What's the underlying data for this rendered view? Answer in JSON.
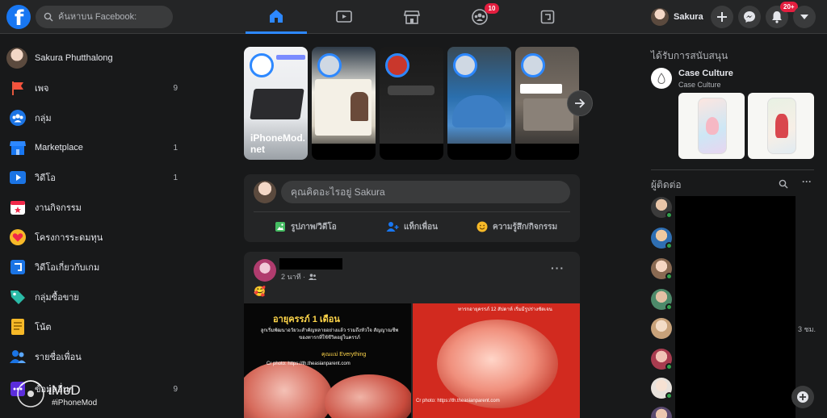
{
  "header": {
    "logo_letter": "f",
    "search_placeholder": "ค้นหาบน Facebook:",
    "nav_tabs": [
      {
        "name": "home",
        "active": true
      },
      {
        "name": "watch"
      },
      {
        "name": "marketplace"
      },
      {
        "name": "groups",
        "badge": "10"
      },
      {
        "name": "gaming"
      }
    ],
    "profile_name": "Sakura",
    "notifications_badge": "20+"
  },
  "sidebar": {
    "profile_name": "Sakura Phutthalong",
    "items": [
      {
        "label": "เพจ",
        "count": "9",
        "icon": "flag-icon"
      },
      {
        "label": "กลุ่ม",
        "count": "",
        "icon": "groups-icon"
      },
      {
        "label": "Marketplace",
        "count": "1",
        "icon": "shop-icon"
      },
      {
        "label": "วิดีโอ",
        "count": "1",
        "icon": "video-icon"
      },
      {
        "label": "งานกิจกรรม",
        "count": "",
        "icon": "calendar-icon"
      },
      {
        "label": "โครงการระดมทุน",
        "count": "",
        "icon": "heart-icon"
      },
      {
        "label": "วิดีโอเกี่ยวกับเกม",
        "count": "",
        "icon": "gaming-icon"
      },
      {
        "label": "กลุ่มซื้อขาย",
        "count": "",
        "icon": "tag-icon"
      },
      {
        "label": "โน้ต",
        "count": "",
        "icon": "notes-icon"
      },
      {
        "label": "รายชื่อเพื่อน",
        "count": "",
        "icon": "friends-icon"
      },
      {
        "label": "ข้อมูลอื่นๆ",
        "count": "9",
        "icon": "more-icon"
      }
    ],
    "watermark_brand": "iMoD",
    "watermark_handle": "#iPhoneMod"
  },
  "stories": {
    "items": [
      {
        "name": "iPhoneMod.\nnet",
        "ring": true
      },
      {
        "name": "",
        "ring": true
      },
      {
        "name": "",
        "ring": true
      },
      {
        "name": "",
        "ring": true
      },
      {
        "name": "",
        "ring": true
      }
    ]
  },
  "composer": {
    "placeholder": "คุณคิดอะไรอยู่ Sakura",
    "photo_label": "รูปภาพ/วิดีโอ",
    "tag_label": "แท็กเพื่อน",
    "feeling_label": "ความรู้สึก/กิจกรรม"
  },
  "post": {
    "time": "2 นาที ·",
    "emoji": "🥰",
    "left_title": "อายุครรภ์ 1 เดือน",
    "left_body": "ลูกเริ่มพัฒนาอวัยวะสำคัญหลายอย่างแล้ว รวมถึงหัวใจ สัญญาณชีพของทารกที่ใช้ชีวิตอยู่ในครรภ์",
    "left_tag": "คุณแม่ Everything",
    "left_credit": "Cr photo: https://th.theasianparent.com",
    "right_caption": "ทารกอายุครรภ์ 12 สัปดาห์ เริ่มมีรูปร่างชัดเจน",
    "right_credit": "Cr photo: https://th.theasianparent.com"
  },
  "right": {
    "sponsored_title": "ได้รับการสนับสนุน",
    "ad_name": "Case Culture",
    "ad_sub": "Case Culture",
    "contacts_title": "ผู้ติดต่อ",
    "time_label": "3 ชม.",
    "contacts": [
      {
        "online": true
      },
      {
        "online": true
      },
      {
        "online": true
      },
      {
        "online": true
      },
      {
        "online": false
      },
      {
        "online": true
      },
      {
        "online": true
      },
      {
        "online": false
      }
    ]
  },
  "colors": {
    "accent": "#2d88ff",
    "background": "#18191a",
    "surface": "#242526",
    "badge": "#e41e3f",
    "online": "#31a24c"
  }
}
